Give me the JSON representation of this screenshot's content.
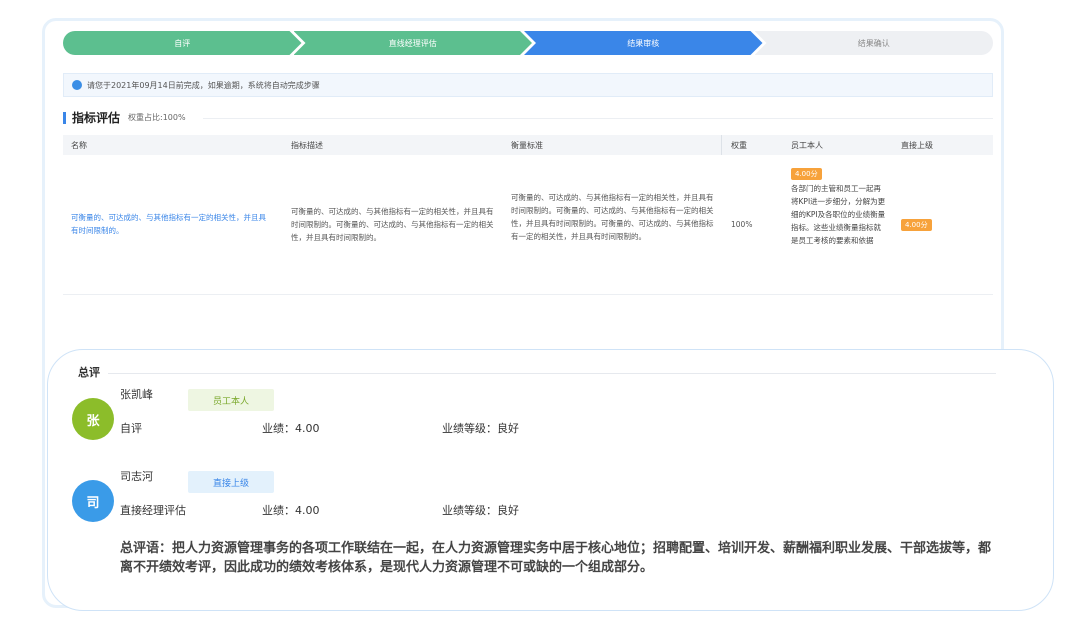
{
  "steps": [
    "自评",
    "直线经理评估",
    "结果审核",
    "结果确认"
  ],
  "notice": "请您于2021年09月14日前完成，如果逾期，系统将自动完成步骤",
  "section": {
    "title": "指标评估",
    "weight": "权重占比:100%"
  },
  "table": {
    "headers": [
      "名称",
      "指标描述",
      "衡量标准",
      "权重",
      "员工本人",
      "直接上级"
    ],
    "row": {
      "name": "可衡量的、可达成的、与其他指标有一定的相关性，并且具有时间限制的。",
      "description": "可衡量的、可达成的、与其他指标有一定的相关性，并且具有时间限制的。可衡量的、可达成的、与其他指标有一定的相关性，并且具有时间限制的。",
      "standard": "可衡量的、可达成的、与其他指标有一定的相关性，并且具有时间限制的。可衡量的、可达成的、与其他指标有一定的相关性，并且具有时间限制的。可衡量的、可达成的、与其他指标有一定的相关性，并且具有时间限制的。",
      "weight": "100%",
      "self_score": "4.00分",
      "self_comment": "各部门的主管和员工一起再将KPI进一步细分，分解为更细的KPI及各职位的业绩衡量指标。这些业绩衡量指标就是员工考核的要素和依据",
      "manager_score": "4.00分"
    }
  },
  "overall": {
    "title": "总评",
    "people": [
      {
        "avatar": "张",
        "name": "张凯峰",
        "role": "员工本人",
        "eval_type": "自评",
        "score": "业绩：4.00",
        "grade": "业绩等级：良好"
      },
      {
        "avatar": "司",
        "name": "司志河",
        "role": "直接上级",
        "eval_type": "直接经理评估",
        "score": "业绩：4.00",
        "grade": "业绩等级：良好"
      }
    ],
    "summary": "总评语：把人力资源管理事务的各项工作联结在一起，在人力资源管理实务中居于核心地位；招聘配置、培训开发、薪酬福利职业发展、干部选拔等，都离不开绩效考评，因此成功的绩效考核体系，是现代人力资源管理不可或缺的一个组成部分。"
  },
  "colors": {
    "green": "#5cbf8f",
    "blue": "#3a86e8",
    "orange": "#f7a23b",
    "avatar_green": "#8cbd2a",
    "avatar_blue": "#3a9be8"
  }
}
